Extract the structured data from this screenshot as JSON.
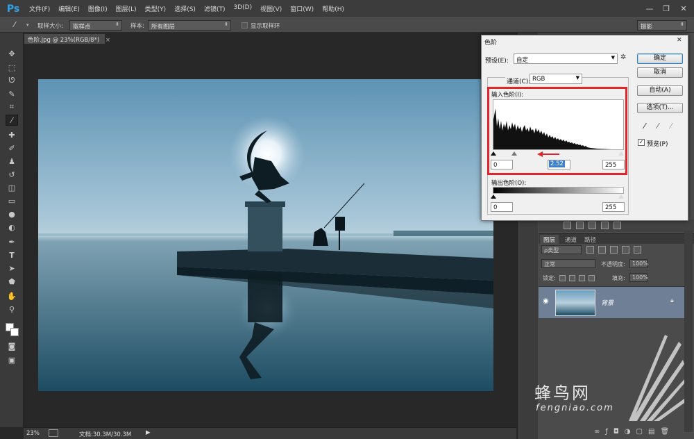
{
  "app": {
    "logo": "Ps"
  },
  "menu": [
    "文件(F)",
    "编辑(E)",
    "图像(I)",
    "图层(L)",
    "类型(Y)",
    "选择(S)",
    "滤镜(T)",
    "3D(D)",
    "视图(V)",
    "窗口(W)",
    "帮助(H)"
  ],
  "window_controls": {
    "minimize": "—",
    "restore": "❐",
    "close": "✕"
  },
  "options_bar": {
    "sample_size_label": "取样大小:",
    "sample_size_value": "取样点",
    "sample_label": "样本:",
    "sample_value": "所有图层",
    "show_ring_label": "显示取样环",
    "workspace_value": "摄影"
  },
  "document_tab": {
    "title": "色阶.jpg @ 23%(RGB/8*)",
    "close": "×"
  },
  "status_bar": {
    "zoom": "23%",
    "doc_size": "文档:30.3M/30.3M",
    "arrow": "▶"
  },
  "levels_dialog": {
    "title": "色阶",
    "close": "✕",
    "preset_label": "预设(E):",
    "preset_value": "自定",
    "channel_label": "通道(C):",
    "channel_value": "RGB",
    "input_levels_label": "输入色阶(I):",
    "input_black": "0",
    "input_gamma": "2.52",
    "input_white": "255",
    "output_levels_label": "输出色阶(O):",
    "output_black": "0",
    "output_white": "255",
    "ok": "确定",
    "cancel": "取消",
    "auto": "自动(A)",
    "options": "选项(T)...",
    "preview_label": "预览(P)",
    "preview_checked": true,
    "highlight_color": "#e0262b"
  },
  "layers_panel": {
    "tabs": [
      "图层",
      "通道",
      "路径"
    ],
    "filter_value": "ρ类型",
    "blend_mode": "正常",
    "opacity_label": "不透明度:",
    "opacity_value": "100%",
    "lock_label": "锁定:",
    "fill_label": "填充:",
    "fill_value": "100%",
    "layer_name": "背景"
  },
  "watermark": {
    "brand": "蜂鸟网",
    "url": "fengniao.com"
  }
}
